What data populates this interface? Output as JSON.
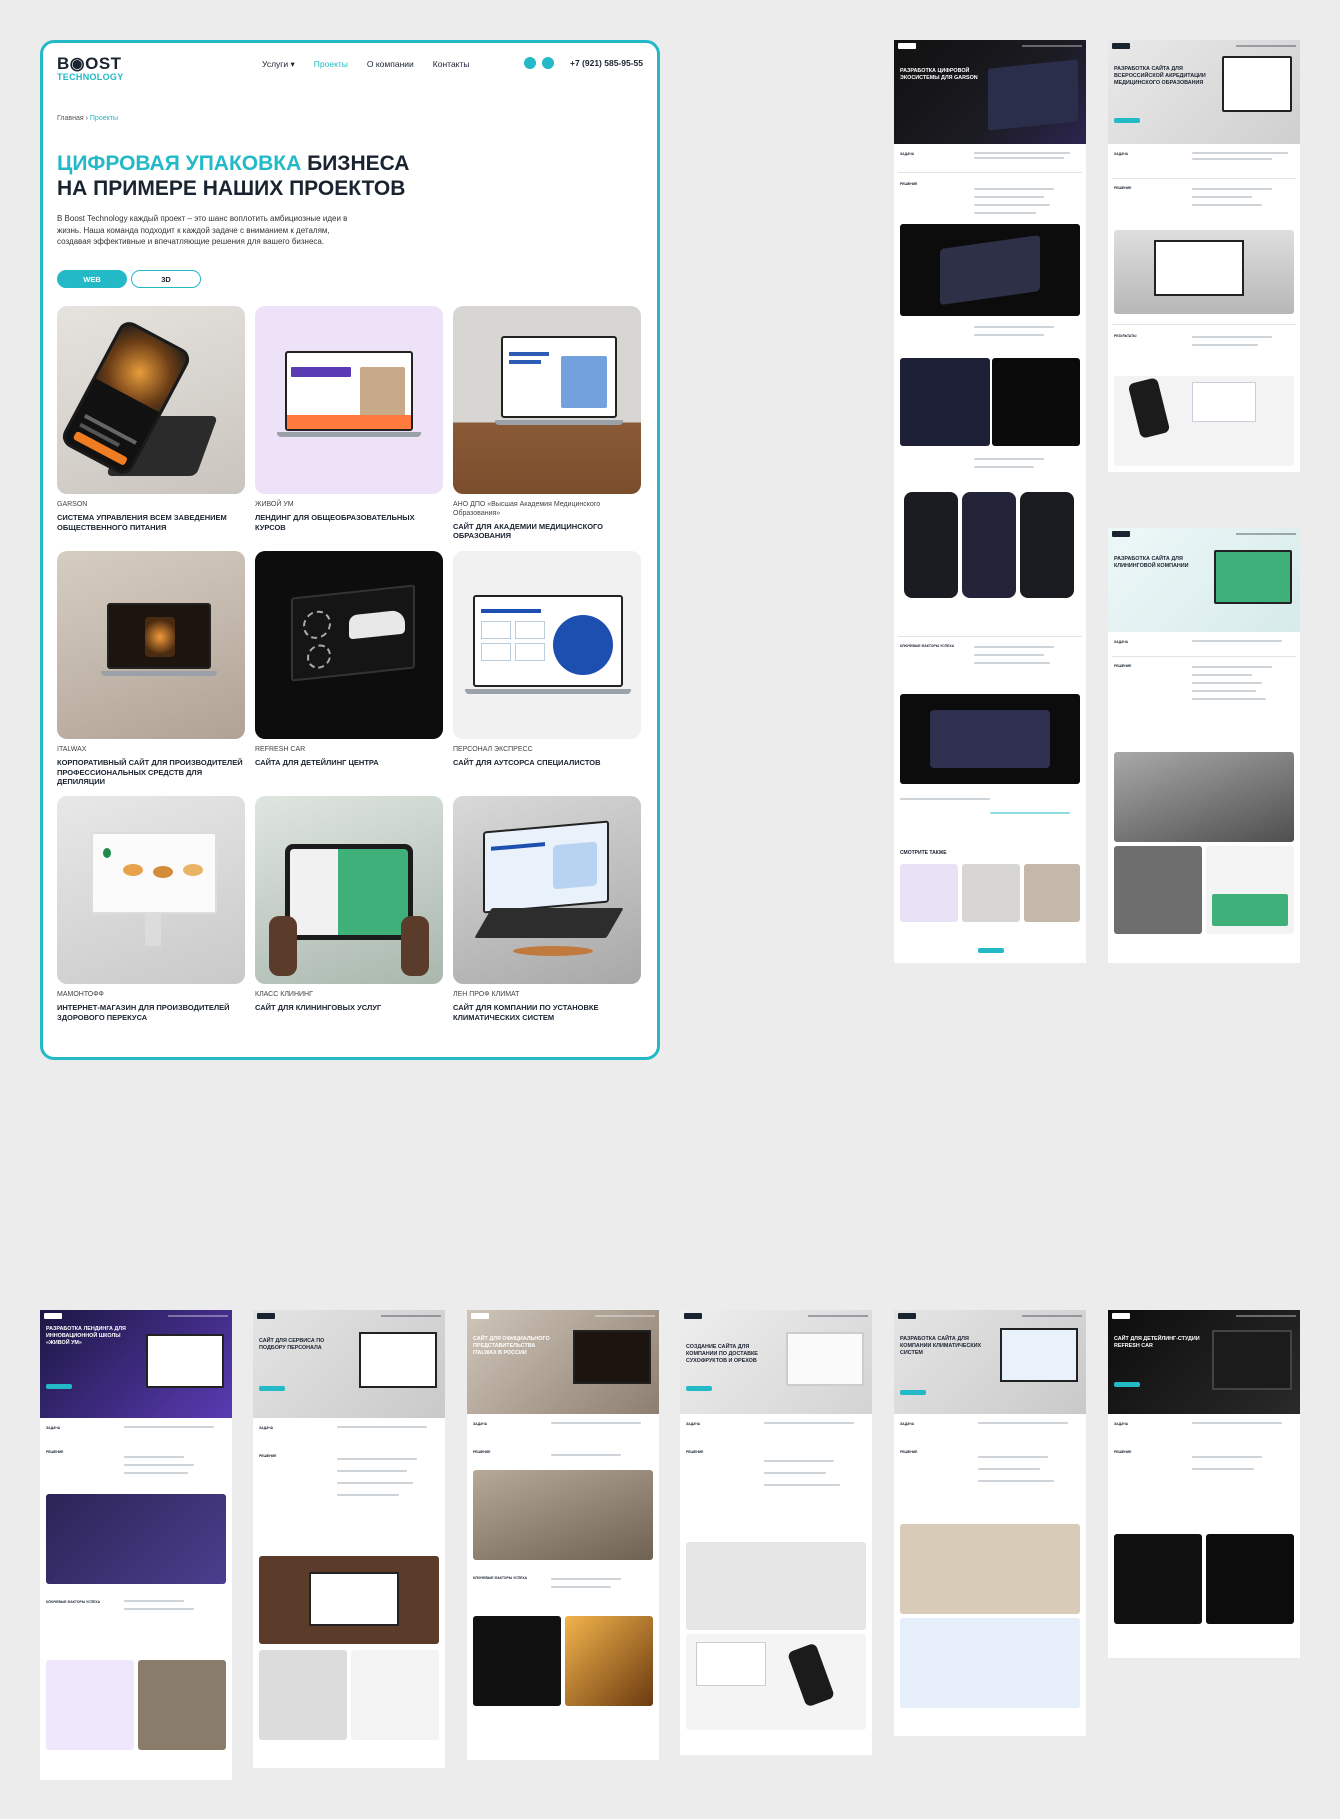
{
  "header": {
    "logo_top": "B◉OST",
    "logo_bottom": "TECHNOLOGY",
    "nav": [
      "Услуги ▾",
      "Проекты",
      "О компании",
      "Контакты"
    ],
    "phone": "+7 (921) 585-95-55"
  },
  "breadcrumbs": {
    "home": "Главная",
    "sep": " › ",
    "current": "Проекты"
  },
  "hero": {
    "title_accent": "ЦИФРОВАЯ УПАКОВКА",
    "title_rest_1": " БИЗНЕСА",
    "title_rest_2": "НА ПРИМЕРЕ НАШИХ ПРОЕКТОВ",
    "description": "В Boost Technology каждый проект – это шанс воплотить амбициозные идеи в жизнь. Наша команда подходит к каждой задаче с вниманием к деталям, создавая эффективные и впечатляющие решения для вашего бизнеса."
  },
  "tabs": [
    "WEB",
    "3D"
  ],
  "projects": [
    {
      "category": "GARSON",
      "name": "СИСТЕМА УПРАВЛЕНИЯ ВСЕМ ЗАВЕДЕНИЕМ ОБЩЕСТВЕННОГО ПИТАНИЯ"
    },
    {
      "category": "ЖИВОЙ УМ",
      "name": "ЛЕНДИНГ ДЛЯ ОБЩЕОБРАЗОВАТЕЛЬНЫХ КУРСОВ"
    },
    {
      "category": "АНО ДПО «Высшая Академия Медицинского Образования»",
      "name": "САЙТ ДЛЯ АКАДЕМИИ МЕДИЦИНСКОГО ОБРАЗОВАНИЯ"
    },
    {
      "category": "ITALWAX",
      "name": "КОРПОРАТИВНЫЙ САЙТ ДЛЯ ПРОИЗВОДИТЕЛЕЙ ПРОФЕССИОНАЛЬНЫХ СРЕДСТВ ДЛЯ ДЕПИЛЯЦИИ"
    },
    {
      "category": "REFRESH CAR",
      "name": "САЙТА ДЛЯ ДЕТЕЙЛИНГ ЦЕНТРА"
    },
    {
      "category": "ПЕРСОНАЛ ЭКСПРЕСС",
      "name": "САЙТ ДЛЯ АУТСОРСА СПЕЦИАЛИСТОВ"
    },
    {
      "category": "МАМОНТОФФ",
      "name": "ИНТЕРНЕТ-МАГАЗИН ДЛЯ ПРОИЗВОДИТЕЛЕЙ ЗДОРОВОГО ПЕРЕКУСА"
    },
    {
      "category": "КЛАСС КЛИНИНГ",
      "name": "САЙТ ДЛЯ КЛИНИНГОВЫХ УСЛУГ"
    },
    {
      "category": "ЛЕН ПРОФ КЛИМАТ",
      "name": "САЙТ ДЛЯ КОМПАНИИ ПО УСТАНОВКЕ КЛИМАТИЧЕСКИХ СИСТЕМ"
    }
  ],
  "pages": {
    "garson_title": "РАЗРАБОТКА ЦИФРОВОЙ ЭКОСИСТЕМЫ ДЛЯ GARSON",
    "vamo_title": "РАЗРАБОТКА САЙТА ДЛЯ ВСЕРОССИЙСКОЙ АКРЕДИТАЦИИ МЕДИЦИНСКОГО ОБРАЗОВАНИЯ",
    "cleaning_title": "РАЗРАБОТКА САЙТА ДЛЯ КЛИНИНГОВОЙ КОМПАНИИ",
    "zhivoy_title": "РАЗРАБОТКА ЛЕНДИНГА ДЛЯ ИННОВАЦИОННОЙ ШКОЛЫ «ЖИВОЙ УМ»",
    "personal_title": "САЙТ ДЛЯ СЕРВИСА ПО ПОДБОРУ ПЕРСОНАЛА",
    "italwax_title": "САЙТ ДЛЯ ОФИЦИАЛЬНОГО ПРЕДСТАВИТЕЛЬСТВА ITALWAX В РОССИИ",
    "mamont_title": "СОЗДАНИЕ САЙТА ДЛЯ КОМПАНИИ ПО ДОСТАВКЕ СУХОФРУКТОВ И ОРЕХОВ",
    "klimat_title": "РАЗРАБОТКА САЙТА ДЛЯ КОМПАНИИ КЛИМАТИЧЕСКИХ СИСТЕМ",
    "refresh_title": "САЙТ ДЛЯ ДЕТЕЙЛИНГ-СТУДИИ REFRESH CAR",
    "label_task": "ЗАДАЧА",
    "label_solution": "РЕШЕНИЕ",
    "label_results": "РЕЗУЛЬТАТЫ",
    "label_key": "КЛЮЧЕВЫЕ ФАКТОРЫ УСПЕХА",
    "see_also": "СМОТРИТЕ ТАКЖЕ"
  },
  "colors": {
    "accent": "#23b9c7",
    "dark": "#1a2330",
    "bg": "#ececec"
  }
}
